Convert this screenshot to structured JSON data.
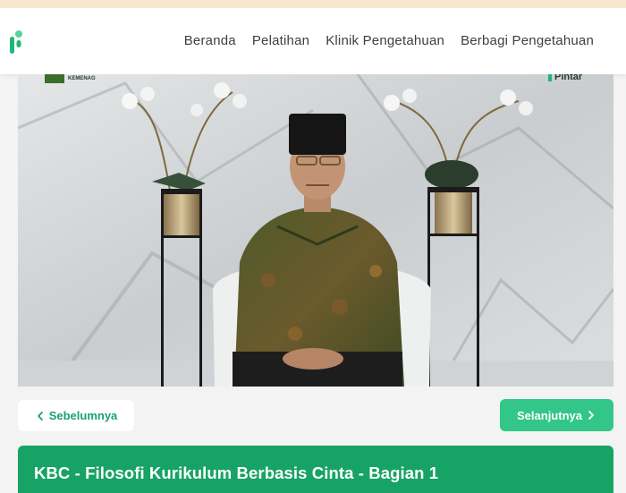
{
  "nav": {
    "items": [
      "Beranda",
      "Pelatihan",
      "Klinik Pengetahuan",
      "Berbagi Pengetahuan"
    ]
  },
  "video": {
    "logo_left_label": "KEMENAG",
    "logo_right_label": "Pintar"
  },
  "pager": {
    "prev_label": "Sebelumnya",
    "next_label": "Selanjutnya"
  },
  "course": {
    "title": "KBC - Filosofi Kurikulum Berbasis Cinta - Bagian 1"
  },
  "colors": {
    "brand_green": "#17a365",
    "button_green": "#33c689",
    "nav_text": "#3c4046",
    "top_strip": "#f9e7cf"
  }
}
